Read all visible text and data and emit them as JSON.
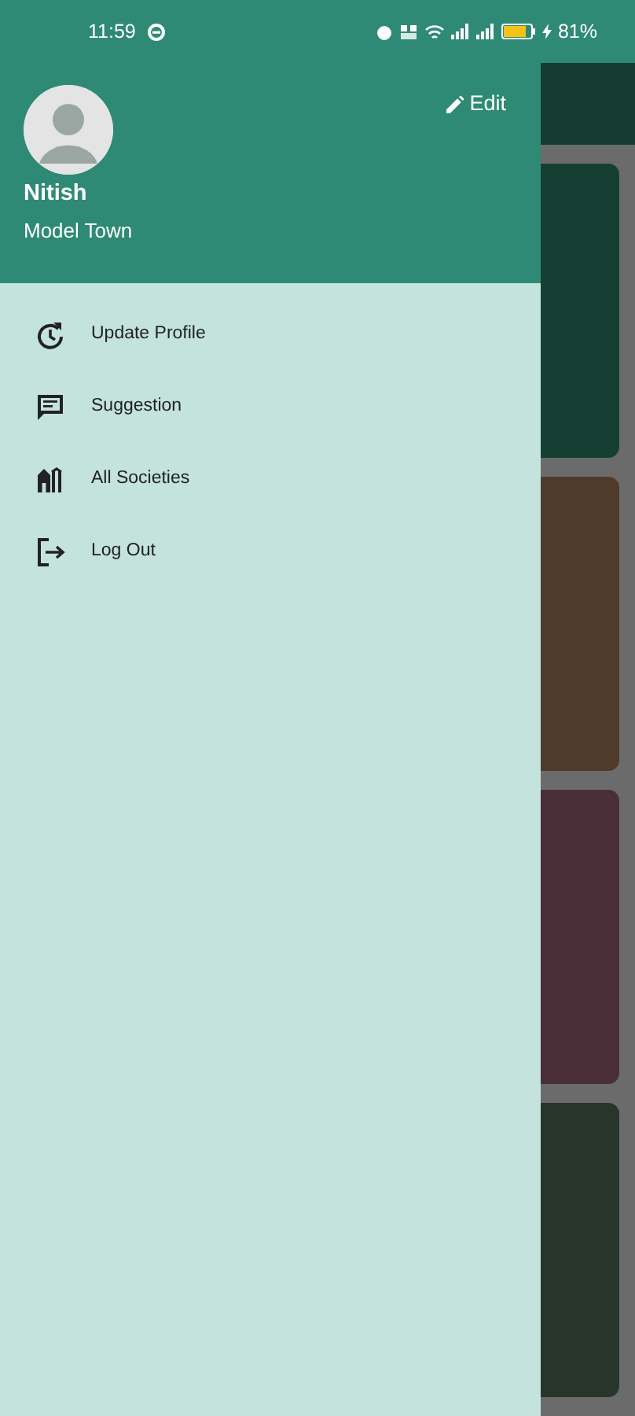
{
  "status_bar": {
    "time": "11:59",
    "battery": "81%"
  },
  "background_cards": [
    {
      "color": "#163f33"
    },
    {
      "color": "#4f3b2b"
    },
    {
      "color": "#4a2e38"
    },
    {
      "color": "#27352a"
    }
  ],
  "drawer": {
    "edit": "Edit",
    "name": "Nitish",
    "location": "Model Town",
    "items": [
      {
        "label": "Update Profile"
      },
      {
        "label": "Suggestion"
      },
      {
        "label": "All Societies"
      },
      {
        "label": "Log Out"
      }
    ]
  }
}
